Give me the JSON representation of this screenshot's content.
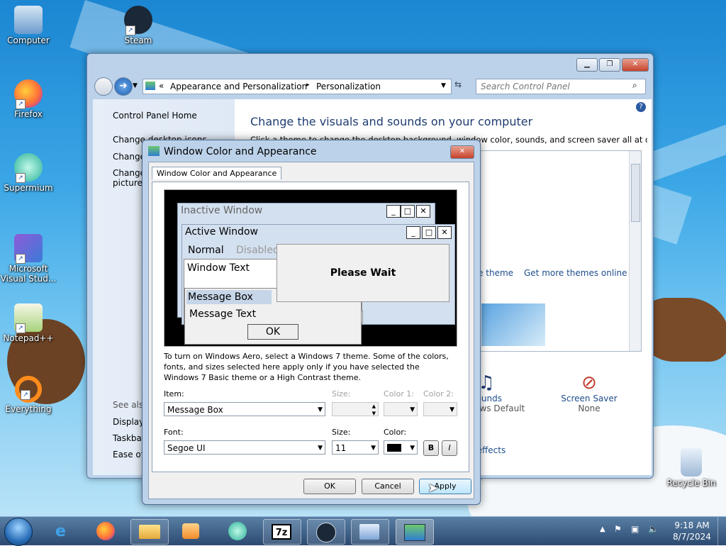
{
  "desktop": {
    "icons": [
      {
        "label": "Computer"
      },
      {
        "label": "Steam"
      },
      {
        "label": "Firefox"
      },
      {
        "label": "Supermium"
      },
      {
        "label": "Microsoft Visual Stud..."
      },
      {
        "label": "Notepad++"
      },
      {
        "label": "Everything"
      },
      {
        "label": "Recycle Bin"
      }
    ]
  },
  "control_panel": {
    "breadcrumb": {
      "prefix": "«",
      "item1": "Appearance and Personalization",
      "sep": "▸",
      "item2": "Personalization"
    },
    "search_placeholder": "Search Control Panel",
    "left": {
      "home": "Control Panel Home",
      "items": [
        "Change desktop icons",
        "Change mouse pointers",
        "Change your account picture"
      ],
      "see_also": "See also",
      "see_also_items": [
        "Display",
        "Taskbar and Start Menu",
        "Ease of Access Center"
      ]
    },
    "main": {
      "title": "Change the visuals and sounds on your computer",
      "subtitle": "Click a theme to change the desktop background, window color, sounds, and screen saver all at once.",
      "save_theme": "Save theme",
      "more_themes": "Get more themes online",
      "sounds_label": "Sounds",
      "sounds_value": "Windows Default",
      "screensaver_label": "Screen Saver",
      "screensaver_value": "None",
      "effects": "Sound effects"
    },
    "accent": "#1e4e8c"
  },
  "dialog": {
    "title": "Window Color and Appearance",
    "tab": "Window Color and Appearance",
    "preview": {
      "inactive": "Inactive Window",
      "active": "Active Window",
      "menu_normal": "Normal",
      "menu_disabled": "Disabled",
      "window_text": "Window Text",
      "please_wait": "Please Wait",
      "message_box": "Message Box",
      "message_text": "Message Text",
      "ok": "OK"
    },
    "description": "To turn on Windows Aero, select a Windows 7 theme.  Some of the colors, fonts, and sizes selected here apply only if you have selected the Windows 7 Basic theme or a High Contrast theme.",
    "item_label": "Item:",
    "item_value": "Message Box",
    "size_label": "Size:",
    "color1_label": "Color 1:",
    "color2_label": "Color 2:",
    "font_label": "Font:",
    "font_value": "Segoe UI",
    "fontsize_label": "Size:",
    "fontsize_value": "11",
    "color_label": "Color:",
    "bold": "B",
    "italic": "I",
    "ok": "OK",
    "cancel": "Cancel",
    "apply": "Apply"
  },
  "taskbar": {
    "time": "9:18 AM",
    "date": "8/7/2024",
    "pinned": [
      "Start",
      "Internet Explorer",
      "Firefox",
      "File Explorer",
      "Media Player",
      "Supermium",
      "7-Zip",
      "Steam",
      "Control Panel",
      "Window Color and Appearance"
    ],
    "seven_zip_label": "7z"
  }
}
